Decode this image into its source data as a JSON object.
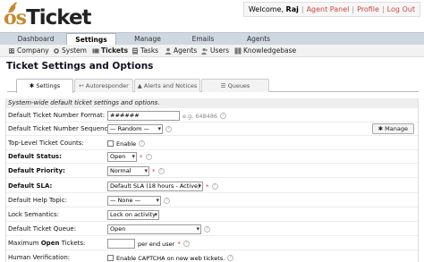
{
  "header": {
    "logo_prefix": "os",
    "logo_text": "Ticket",
    "welcome": "Welcome,",
    "user_name": "Raj",
    "links": [
      "Agent Panel",
      "Profile",
      "Log Out"
    ]
  },
  "main_nav": [
    "Dashboard",
    "Settings",
    "Manage",
    "Emails",
    "Agents"
  ],
  "sub_nav": [
    "Company",
    "System",
    "Tickets",
    "Tasks",
    "Agents",
    "Users",
    "Knowledgebase"
  ],
  "page_title": "Ticket Settings and Options",
  "section_tabs": [
    "Settings",
    "Autoresponder",
    "Alerts and Notices",
    "Queues"
  ],
  "intro": "System-wide default ticket settings and options.",
  "fields": {
    "number_format": {
      "label": "Default Ticket Number Format:",
      "value": "######",
      "hint": "e.g. 648486"
    },
    "number_sequence": {
      "label": "Default Ticket Number Sequence:",
      "value": "— Random —",
      "button": "Manage"
    },
    "top_level_counts": {
      "label": "Top-Level Ticket Counts:",
      "option": "Enable"
    },
    "status": {
      "label": "Default Status:",
      "value": "Open",
      "required": "*"
    },
    "priority": {
      "label": "Default Priority:",
      "value": "Normal",
      "required": "*"
    },
    "sla": {
      "label": "Default SLA:",
      "value": "Default SLA (18 hours - Active)",
      "required": "*"
    },
    "help_topic": {
      "label": "Default Help Topic:",
      "value": "— None —"
    },
    "lock_semantics": {
      "label": "Lock Semantics:",
      "value": "Lock on activity"
    },
    "queue": {
      "label": "Default Ticket Queue:",
      "value": "Open"
    },
    "max_open": {
      "label_prefix": "Maximum",
      "label_bold": "Open",
      "label_suffix": "Tickets:",
      "value": "",
      "suffix": "per end user",
      "required": "*"
    },
    "human_verification": {
      "label": "Human Verification:",
      "option": "Enable CAPTCHA on new web tickets."
    }
  },
  "colors": {
    "accent_link": "#cc4444",
    "nav_bg": "#cfd8e0",
    "required": "#ee3333"
  },
  "icons": [
    "kangaroo-logo-icon",
    "company-icon",
    "system-icon",
    "tickets-icon",
    "tasks-icon",
    "agents-icon",
    "users-icon",
    "knowledgebase-icon",
    "gear-icon",
    "reply-icon",
    "bell-icon",
    "list-icon",
    "help-icon"
  ]
}
